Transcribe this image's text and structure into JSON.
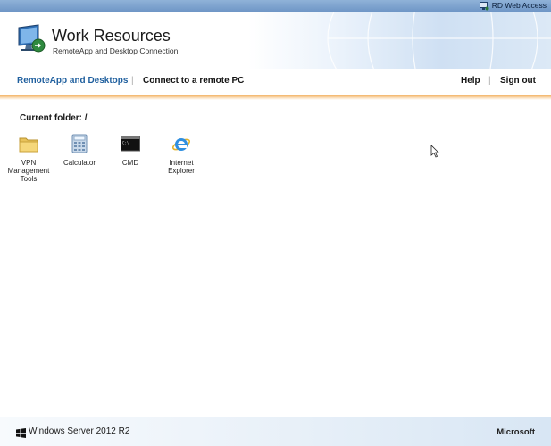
{
  "topbar": {
    "brand_label": "RD Web Access"
  },
  "header": {
    "title": "Work Resources",
    "subtitle": "RemoteApp and Desktop Connection"
  },
  "nav": {
    "tabs": [
      {
        "label": "RemoteApp and Desktops",
        "active": true
      },
      {
        "label": "Connect to a remote PC",
        "active": false
      }
    ],
    "right": [
      {
        "label": "Help"
      },
      {
        "label": "Sign out"
      }
    ]
  },
  "content": {
    "folder_label": "Current folder: /",
    "apps": [
      {
        "label": "VPN Management Tools",
        "icon": "folder-icon"
      },
      {
        "label": "Calculator",
        "icon": "calculator-icon"
      },
      {
        "label": "CMD",
        "icon": "command-prompt-icon"
      },
      {
        "label": "Internet Explorer",
        "icon": "internet-explorer-icon"
      }
    ]
  },
  "footer": {
    "product": "Windows Server 2012 R2",
    "vendor": "Microsoft"
  },
  "colors": {
    "active_nav": "#1f5f9e",
    "nav_text": "#111111",
    "accent_line": "#f0a040",
    "top_strip": "#7ea4cf"
  }
}
